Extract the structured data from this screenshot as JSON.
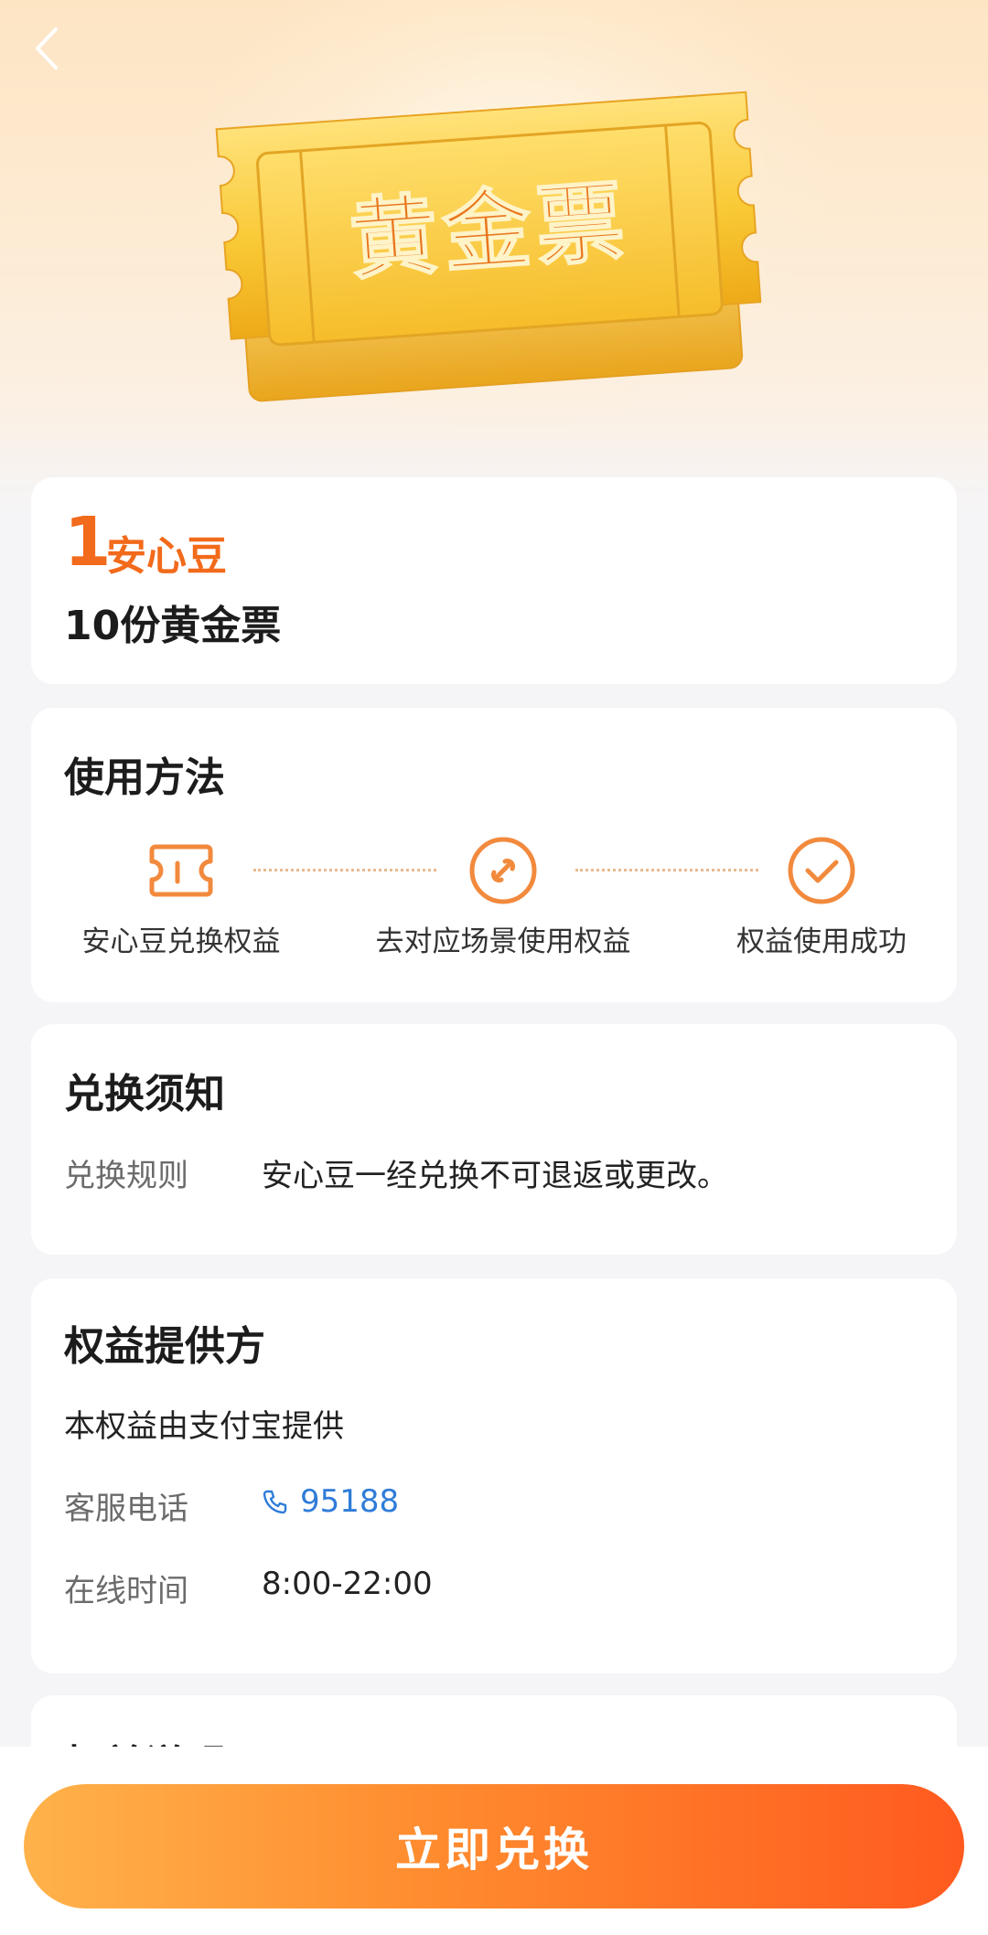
{
  "hero": {
    "ticket_text": "黄金票"
  },
  "product": {
    "price_number": "1",
    "price_unit": "安心豆",
    "name": "10份黄金票"
  },
  "usage": {
    "title": "使用方法",
    "steps": [
      {
        "icon": "ticket-icon",
        "label": "安心豆兑换权益"
      },
      {
        "icon": "link-icon",
        "label": "去对应场景使用权益"
      },
      {
        "icon": "check-circle-icon",
        "label": "权益使用成功"
      }
    ]
  },
  "notice": {
    "title": "兑换须知",
    "rule_label": "兑换规则",
    "rule_value": "安心豆一经兑换不可退返或更改。"
  },
  "provider": {
    "title": "权益提供方",
    "desc": "本权益由支付宝提供",
    "service_label": "客服电话",
    "phone": "95188",
    "hours_label": "在线时间",
    "hours": "8:00-22:00"
  },
  "details": {
    "title": "权益说明"
  },
  "cta": {
    "label": "立即兑换"
  },
  "colors": {
    "accent": "#f26a1b",
    "link": "#2f7cd8",
    "ticket_gold": "#f7c52e"
  }
}
